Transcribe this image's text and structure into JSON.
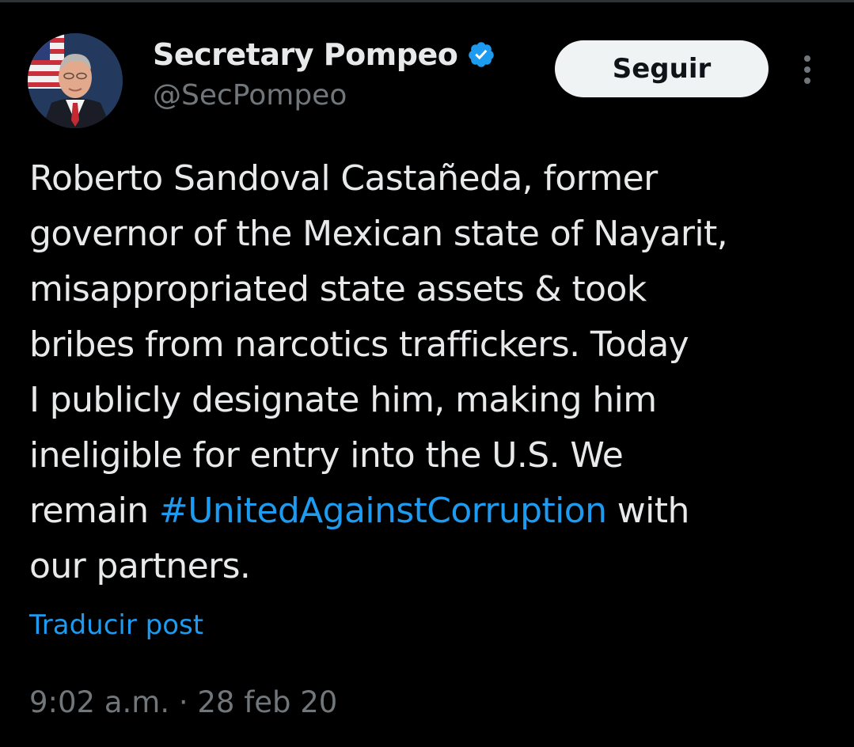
{
  "author": {
    "display_name": "Secretary Pompeo",
    "handle": "@SecPompeo",
    "verified_icon": "verified-badge-icon",
    "avatar": "profile-photo"
  },
  "actions": {
    "follow_label": "Seguir",
    "more_icon": "more-vertical-icon"
  },
  "tweet": {
    "lines": [
      "Roberto Sandoval Castañeda, former",
      "governor of the Mexican state of Nayarit,",
      "misappropriated state assets & took",
      "bribes from narcotics traffickers. Today",
      "I publicly designate him, making him",
      "ineligible for entry into the U.S. We"
    ],
    "line7_before": "remain ",
    "hashtag": "#UnitedAgainstCorruption",
    "line7_after": " with",
    "line8": "our partners."
  },
  "translate_label": "Traducir post",
  "timestamp": "9:02 a.m. · 28 feb 20",
  "colors": {
    "background": "#000000",
    "text": "#e7e9ea",
    "secondary": "#71767b",
    "link": "#1d9bf0",
    "button_bg": "#eff3f4"
  }
}
